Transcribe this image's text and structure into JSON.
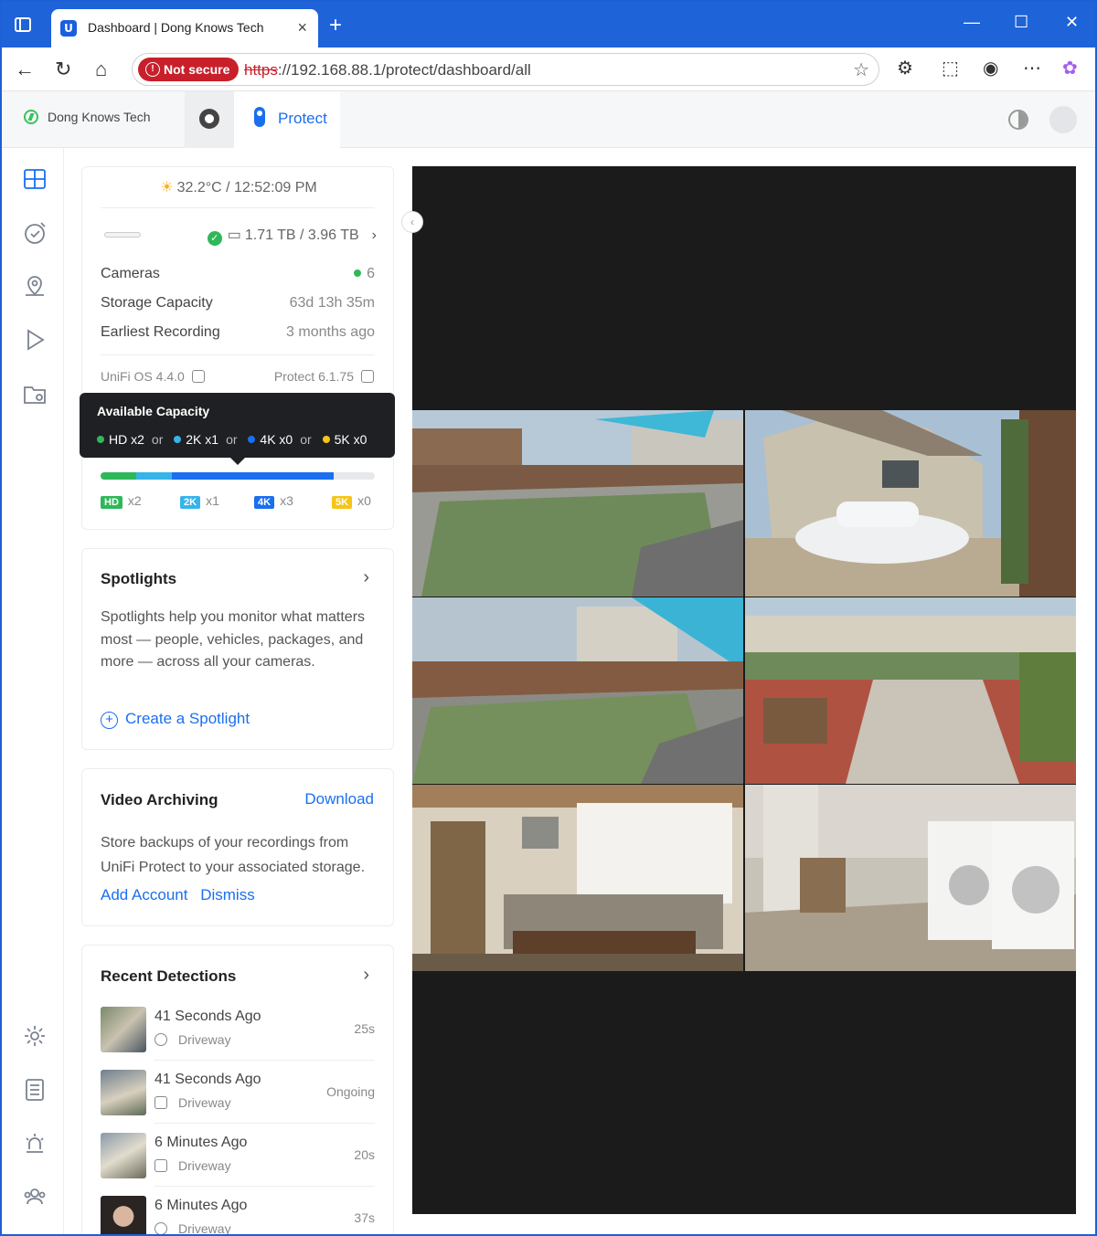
{
  "browser": {
    "tab_title": "Dashboard | Dong Knows Tech",
    "tab_favicon": "U",
    "security_label": "Not secure",
    "url_scheme": "https",
    "url_rest": "://192.168.88.1/protect/dashboard/all"
  },
  "app": {
    "site_name": "Dong Knows Tech",
    "active_app": "Protect"
  },
  "status": {
    "weather": "32.2°C / 12:52:09 PM",
    "storage": "1.71 TB / 3.96 TB",
    "rows": [
      {
        "label": "Cameras",
        "value": "6"
      },
      {
        "label": "Storage Capacity",
        "value": "63d 13h 35m"
      },
      {
        "label": "Earliest Recording",
        "value": "3 months ago"
      }
    ],
    "os_version": "UniFi OS 4.4.0",
    "protect_version": "Protect 6.1.75"
  },
  "capacity": {
    "tooltip_title": "Available Capacity",
    "tooltip_items": [
      {
        "label": "HD x2",
        "color": "#2fb85a"
      },
      {
        "label": "2K x1",
        "color": "#36b4ea"
      },
      {
        "label": "4K x0",
        "color": "#1a6ff0"
      },
      {
        "label": "5K x0",
        "color": "#f5c518"
      }
    ],
    "or_word": "or",
    "bar_fractions": {
      "hd_used": 0.13,
      "2k_used": 0.13,
      "4k_used": 0.59,
      "free": 0.15
    },
    "legend": [
      {
        "badge": "HD",
        "count": "x2",
        "color": "#2fb85a"
      },
      {
        "badge": "2K",
        "count": "x1",
        "color": "#36b4ea"
      },
      {
        "badge": "4K",
        "count": "x3",
        "color": "#1a6ff0"
      },
      {
        "badge": "5K",
        "count": "x0",
        "color": "#f5c518"
      }
    ]
  },
  "spotlights": {
    "title": "Spotlights",
    "body": "Spotlights help you monitor what matters most — people, vehicles, packages, and more — across all your cameras.",
    "action": "Create a Spotlight"
  },
  "archiving": {
    "title": "Video Archiving",
    "download": "Download",
    "body": "Store backups of your recordings from UniFi Protect to your associated storage.",
    "add_account": "Add Account",
    "dismiss": "Dismiss"
  },
  "detections": {
    "title": "Recent Detections",
    "items": [
      {
        "when": "41 Seconds Ago",
        "camera": "Driveway",
        "duration": "25s",
        "icon": "face-icon"
      },
      {
        "when": "41 Seconds Ago",
        "camera": "Driveway",
        "duration": "Ongoing",
        "icon": "vehicle-icon"
      },
      {
        "when": "6 Minutes Ago",
        "camera": "Driveway",
        "duration": "20s",
        "icon": "vehicle-icon"
      },
      {
        "when": "6 Minutes Ago",
        "camera": "Driveway",
        "duration": "37s",
        "icon": "face-icon"
      }
    ]
  }
}
